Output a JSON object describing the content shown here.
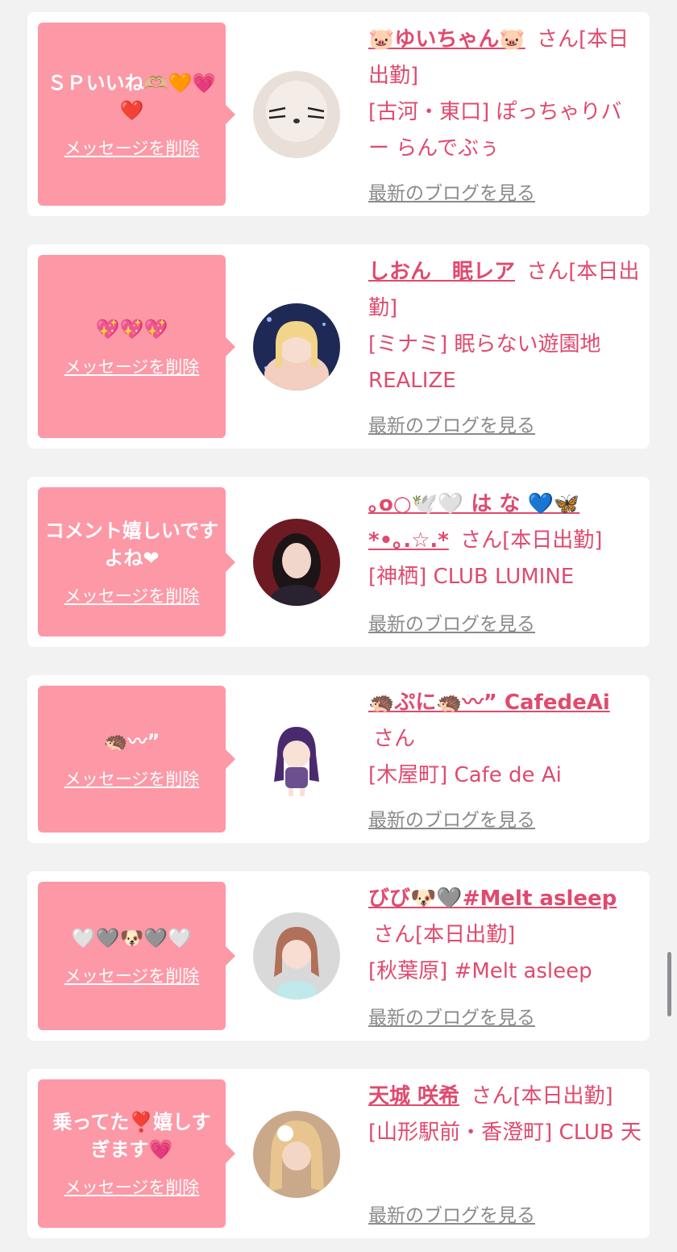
{
  "delete_label": "メッセージを削除",
  "blog_label": "最新のブログを見る",
  "colors": {
    "page_bg": "#f2f2f2",
    "bubble_bg": "#fd98a6",
    "accent_pink": "#e04a6e",
    "link_gray": "#8a8a8a"
  },
  "messages": [
    {
      "message": "ＳＰいいね🫶🏼🧡💗❤️",
      "name": "🐷ゆいちゃん🐷",
      "suffix": "さん[本日出勤]",
      "shop": "[古河・東口] ぽっちゃりバー らんでぶぅ"
    },
    {
      "message": "💖💖💖",
      "name": "しおん　眠レア",
      "suffix": "さん[本日出勤]",
      "shop": "[ミナミ] 眠らない遊園地REALIZE"
    },
    {
      "message": "コメント嬉しいですよね❤",
      "name": "｡o○🕊️🤍 は な 💙🦋*•｡.☆.*",
      "suffix": "さん[本日出勤]",
      "shop": "[神栖] CLUB LUMINE"
    },
    {
      "message": "🦔〰”",
      "name": "🦔ぷに🦔〰” CafedeAi",
      "suffix": "さん",
      "shop": "[木屋町] Cafe de Ai"
    },
    {
      "message": "🤍🩶🐶🩶🤍",
      "name": "びび🐶🩶#Melt asleep",
      "suffix": "さん[本日出勤]",
      "shop": "[秋葉原] #Melt asleep"
    },
    {
      "message": "乗ってた❣️嬉しすぎます💗",
      "name": "天城 咲希",
      "suffix": "さん[本日出勤]",
      "shop": "[山形駅前・香澄町] CLUB 天"
    }
  ]
}
